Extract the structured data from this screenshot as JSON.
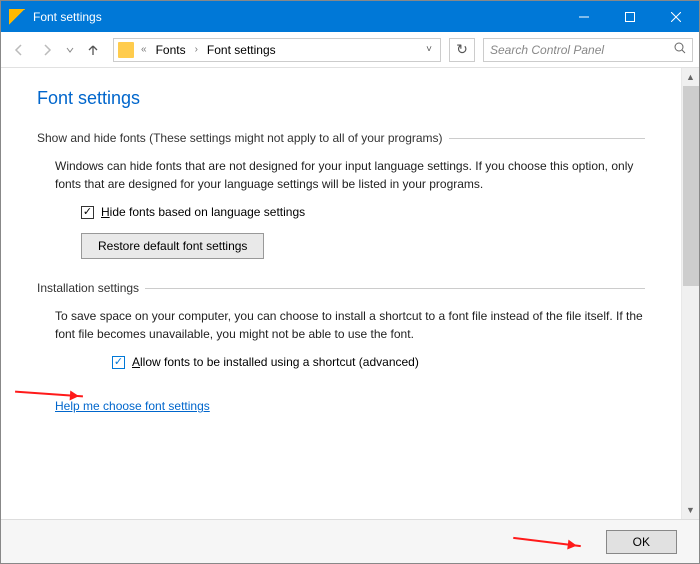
{
  "titlebar": {
    "title": "Font settings"
  },
  "nav": {
    "breadcrumb": {
      "prefix": "«",
      "item1": "Fonts",
      "item2": "Font settings"
    },
    "search_placeholder": "Search Control Panel"
  },
  "page": {
    "heading": "Font settings",
    "group1": {
      "title": "Show and hide fonts (These settings might not apply to all of your programs)",
      "para": "Windows can hide fonts that are not designed for your input language settings. If you choose this option, only fonts that are designed for your language settings will be listed in your programs.",
      "checkbox_label_pre": "",
      "checkbox_label_u": "H",
      "checkbox_label_post": "ide fonts based on language settings",
      "checkbox_checked": true,
      "button_u": "R",
      "button_post": "estore default font settings"
    },
    "group2": {
      "title": "Installation settings",
      "para": "To save space on your computer, you can choose to install a shortcut to a font file instead of the file itself. If the font file becomes unavailable, you might not be able to use the font.",
      "checkbox_label_u": "A",
      "checkbox_label_post": "llow fonts to be installed using a shortcut (advanced)",
      "checkbox_checked": true
    },
    "help_link": "Help me choose font settings"
  },
  "footer": {
    "ok": "OK"
  }
}
